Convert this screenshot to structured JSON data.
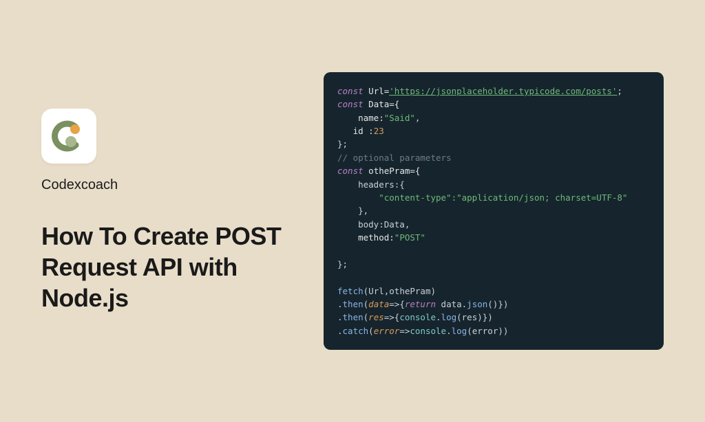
{
  "brand": "Codexcoach",
  "title": "How To Create POST Request API with Node.js",
  "code": {
    "l1": {
      "kw": "const",
      "var": " Url=",
      "url": "'https://jsonplaceholder.typicode.com/posts'",
      "end": ";"
    },
    "l2": {
      "kw": "const",
      "var": " Data={"
    },
    "l3": {
      "prop": "    name:",
      "str": "\"Said\"",
      "end": ","
    },
    "l4": {
      "prop": "   id :",
      "num": "23"
    },
    "l5": "};",
    "l6": "// optional parameters",
    "l7": {
      "kw": "const",
      "var": " othePram={"
    },
    "l8": "    headers:{",
    "l9": {
      "indent": "        ",
      "str": "\"content-type\":\"application/json; charset=UTF-8\""
    },
    "l10": "    },",
    "l11": "    body:Data,",
    "l12": {
      "prop": "    method:",
      "str": "\"POST\""
    },
    "l13blank": "",
    "l14": "};",
    "l15blank": "",
    "l16": {
      "fn": "fetch",
      "args": "(Url,othePram)"
    },
    "l17": {
      "dot": ".",
      "fn": "then",
      "open": "(",
      "param": "data",
      "arrow": "=>{",
      "kw": "return",
      "body": " data.",
      "fn2": "json",
      "call": "()})"
    },
    "l18": {
      "dot": ".",
      "fn": "then",
      "open": "(",
      "param": "res",
      "arrow": "=>{",
      "obj": "console",
      "body": ".",
      "fn2": "log",
      "args": "(res)})"
    },
    "l19": {
      "dot": ".",
      "fn": "catch",
      "open": "(",
      "param": "error",
      "arrow": "=>",
      "obj": "console",
      "body": ".",
      "fn2": "log",
      "args": "(error))"
    }
  }
}
